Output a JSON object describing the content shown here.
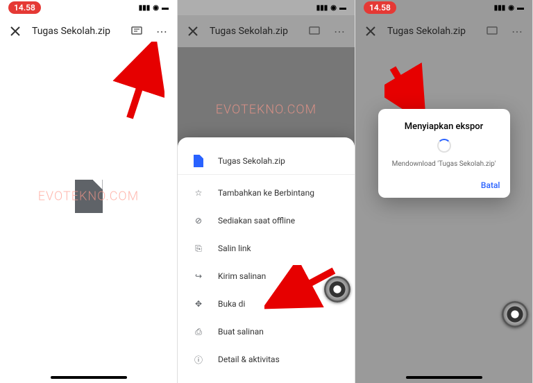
{
  "status": {
    "time": "14.58"
  },
  "header": {
    "filename": "Tugas Sekolah.zip"
  },
  "watermark": "EVOTEKNO.COM",
  "sheet": {
    "filename": "Tugas Sekolah.zip",
    "items": {
      "star": "Tambahkan ke Berbintang",
      "offline": "Sediakan saat offline",
      "copylink": "Salin link",
      "send": "Kirim salinan",
      "openin": "Buka di",
      "makecopy": "Buat salinan",
      "detail": "Detail & aktivitas"
    }
  },
  "dialog": {
    "title": "Menyiapkan ekspor",
    "message": "Mendownload 'Tugas Sekolah.zip'",
    "cancel": "Batal"
  }
}
